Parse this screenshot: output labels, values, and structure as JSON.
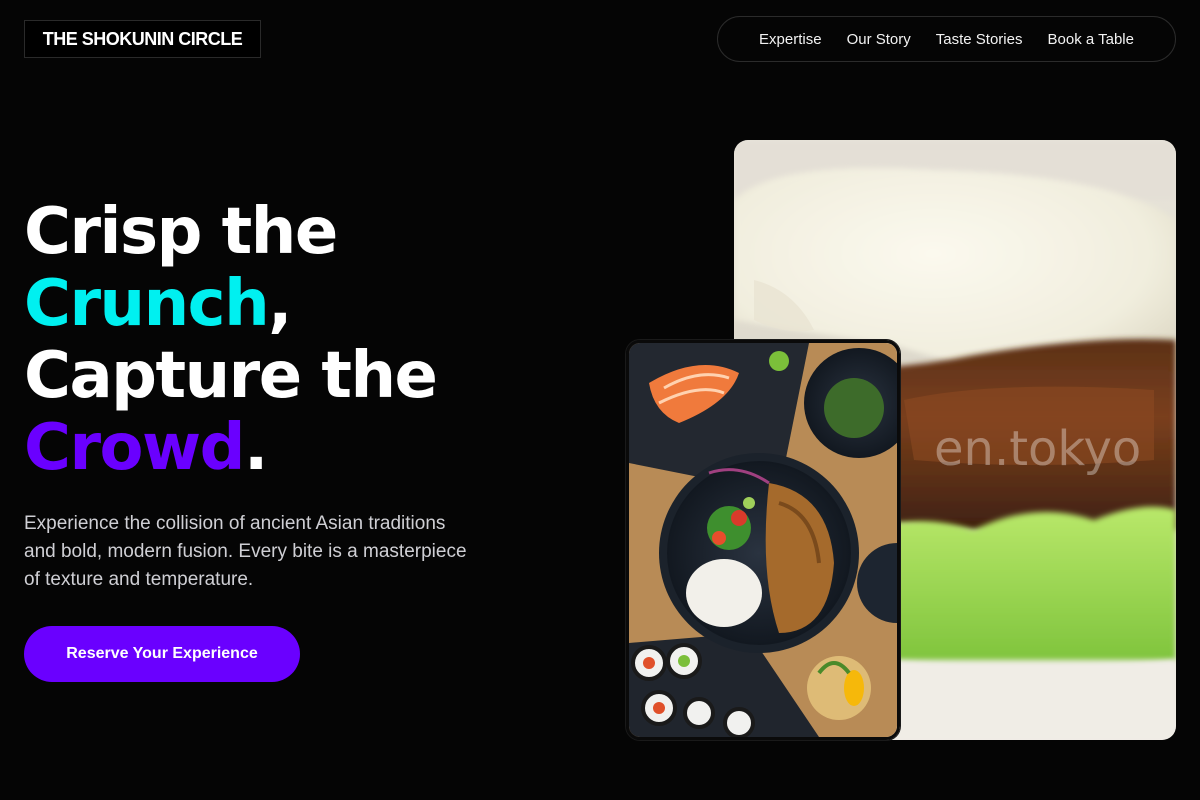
{
  "brand": {
    "name": "THE SHOKUNIN CIRCLE"
  },
  "nav": {
    "items": [
      {
        "label": "Expertise"
      },
      {
        "label": "Our Story"
      },
      {
        "label": "Taste Stories"
      },
      {
        "label": "Book a Table"
      }
    ]
  },
  "hero": {
    "line1": "Crisp the",
    "word_crunch": "Crunch",
    "comma": ",",
    "line3": "Capture the",
    "word_crowd": "Crowd",
    "period": ".",
    "description": "Experience the collision of ancient Asian traditions and bold, modern fusion. Every bite is a masterpiece of texture and temperature.",
    "cta_label": "Reserve Your Experience"
  },
  "images": {
    "large": {
      "icon": "bao-bun-photo",
      "watermark": "en.tokyo"
    },
    "small": {
      "icon": "sushi-platter-photo"
    }
  },
  "colors": {
    "background": "#050505",
    "accent_cyan": "#00f0f0",
    "accent_violet": "#6a00ff",
    "cta": "#6a00ff"
  }
}
